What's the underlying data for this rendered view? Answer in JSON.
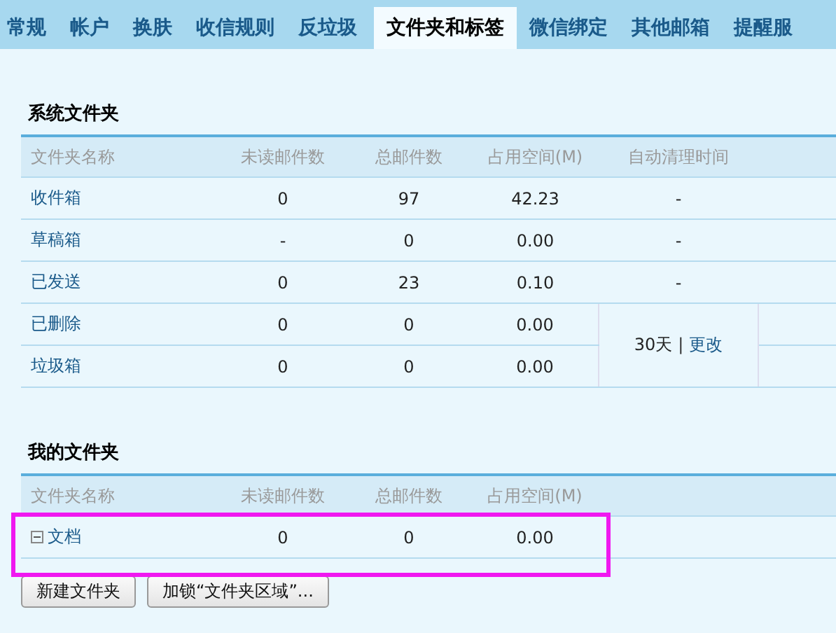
{
  "tabs": [
    {
      "label": "常规",
      "selected": false
    },
    {
      "label": "帐户",
      "selected": false
    },
    {
      "label": "换肤",
      "selected": false
    },
    {
      "label": "收信规则",
      "selected": false
    },
    {
      "label": "反垃圾",
      "selected": false
    },
    {
      "label": "文件夹和标签",
      "selected": true
    },
    {
      "label": "微信绑定",
      "selected": false
    },
    {
      "label": "其他邮箱",
      "selected": false
    },
    {
      "label": "提醒服",
      "selected": false
    }
  ],
  "system_folders": {
    "title": "系统文件夹",
    "columns": [
      "文件夹名称",
      "未读邮件数",
      "总邮件数",
      "占用空间(M)",
      "自动清理时间"
    ],
    "rows": [
      {
        "name": "收件箱",
        "unread": "0",
        "total": "97",
        "size": "42.23",
        "auto_clean": "-"
      },
      {
        "name": "草稿箱",
        "unread": "-",
        "total": "0",
        "size": "0.00",
        "auto_clean": "-"
      },
      {
        "name": "已发送",
        "unread": "0",
        "total": "23",
        "size": "0.10",
        "auto_clean": "-"
      },
      {
        "name": "已删除",
        "unread": "0",
        "total": "0",
        "size": "0.00",
        "auto_clean": "30天",
        "auto_clean_separator": "|",
        "auto_clean_link": "更改"
      },
      {
        "name": "垃圾箱",
        "unread": "0",
        "total": "0",
        "size": "0.00",
        "auto_clean_merged": true
      }
    ]
  },
  "my_folders": {
    "title": "我的文件夹",
    "columns": [
      "文件夹名称",
      "未读邮件数",
      "总邮件数",
      "占用空间(M)"
    ],
    "rows": [
      {
        "name": "文档",
        "expanded": true,
        "highlighted": true,
        "unread": "0",
        "total": "0",
        "size": "0.00"
      }
    ]
  },
  "buttons": [
    "新建文件夹",
    "加锁“文件夹区域”..."
  ]
}
